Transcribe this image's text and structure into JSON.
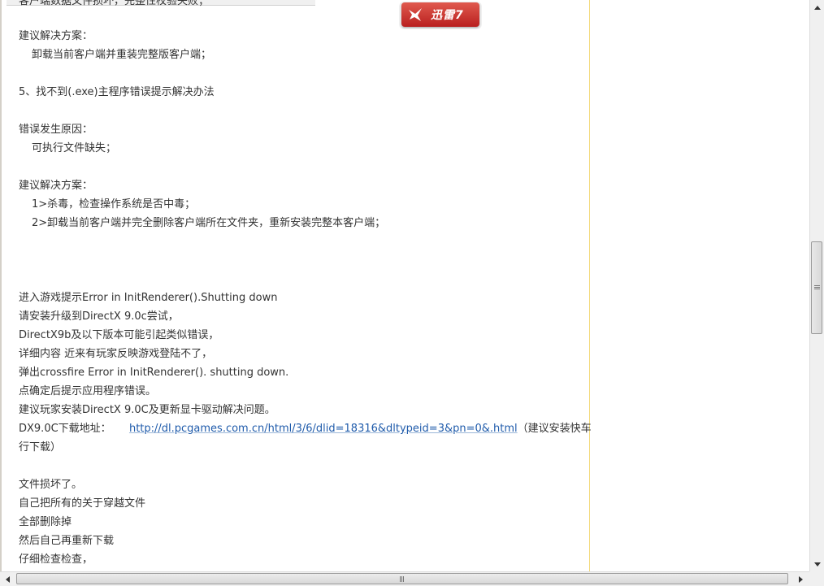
{
  "badge": {
    "text": "迅雷7",
    "icon": "thunder-bird-icon"
  },
  "article": {
    "cut_line": "客户端数据文件损坏，完整性校验失败；",
    "lines": [
      "建议解决方案：",
      "卸载当前客户端并重装完整版客户端；",
      "5、找不到(.exe)主程序错误提示解决办法",
      "错误发生原因：",
      "可执行文件缺失；",
      "建议解决方案：",
      "1>杀毒，检查操作系统是否中毒；",
      "2>卸载当前客户端并完全删除客户端所在文件夹，重新安装完整本客户端；",
      "进入游戏提示Error in InitRenderer().Shutting down",
      "请安装升级到DirectX 9.0c尝试，",
      "DirectX9b及以下版本可能引起类似错误，",
      "详细内容  近来有玩家反映游戏登陆不了，",
      "弹出crossfire Error in InitRenderer(). shutting down.",
      "点确定后提示应用程序错误。",
      "建议玩家安装DirectX 9.0C及更新显卡驱动解决问题。"
    ],
    "download_label": "DX9.0C下载地址：",
    "download_url": "http://dl.pcgames.com.cn/html/3/6/dlid=18316&dltypeid=3&pn=0&.html",
    "download_suffix": "（建议安装快车进",
    "download_suffix2": "行下载）",
    "lines2": [
      "文件损坏了。",
      "自己把所有的关于穿越文件",
      "全部删除掉",
      "然后自己再重新下载",
      "仔细检查检查，"
    ]
  },
  "scrollbar": {
    "vertical_position": 0.52,
    "up_icon": "arrow-up-icon",
    "down_icon": "arrow-down-icon",
    "left_icon": "arrow-left-icon",
    "right_icon": "arrow-right-icon"
  }
}
